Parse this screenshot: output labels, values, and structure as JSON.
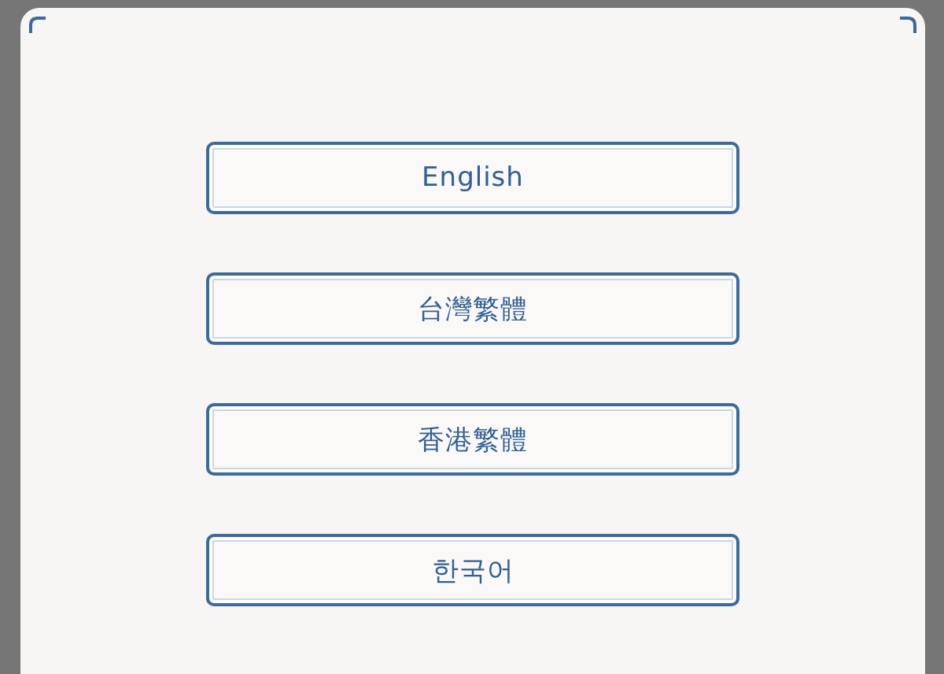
{
  "languages": [
    {
      "label": "English"
    },
    {
      "label": "台灣繁體"
    },
    {
      "label": "香港繁體"
    },
    {
      "label": "한국어"
    }
  ]
}
